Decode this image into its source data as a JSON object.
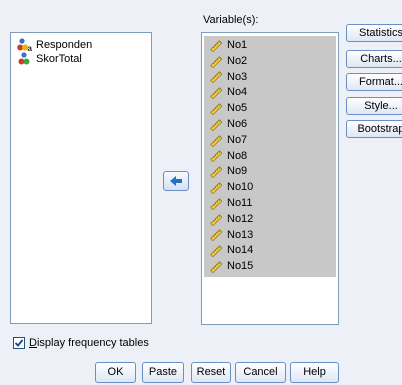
{
  "source_list": {
    "items": [
      {
        "label": "Responden",
        "icon": "nominal-string-variable-icon"
      },
      {
        "label": "SkorTotal",
        "icon": "nominal-variable-icon"
      }
    ]
  },
  "target_list": {
    "label": "Variable(s):",
    "items": [
      {
        "label": "No1",
        "icon": "scale-ruler-icon"
      },
      {
        "label": "No2",
        "icon": "scale-ruler-icon"
      },
      {
        "label": "No3",
        "icon": "scale-ruler-icon"
      },
      {
        "label": "No4",
        "icon": "scale-ruler-icon"
      },
      {
        "label": "No5",
        "icon": "scale-ruler-icon"
      },
      {
        "label": "No6",
        "icon": "scale-ruler-icon"
      },
      {
        "label": "No7",
        "icon": "scale-ruler-icon"
      },
      {
        "label": "No8",
        "icon": "scale-ruler-icon"
      },
      {
        "label": "No9",
        "icon": "scale-ruler-icon"
      },
      {
        "label": "No10",
        "icon": "scale-ruler-icon"
      },
      {
        "label": "No11",
        "icon": "scale-ruler-icon"
      },
      {
        "label": "No12",
        "icon": "scale-ruler-icon"
      },
      {
        "label": "No13",
        "icon": "scale-ruler-icon"
      },
      {
        "label": "No14",
        "icon": "scale-ruler-icon"
      },
      {
        "label": "No15",
        "icon": "scale-ruler-icon"
      }
    ]
  },
  "side_buttons": {
    "statistics": "Statistics",
    "charts": "Charts...",
    "format": "Format...",
    "style": "Style...",
    "bootstrap": "Bootstrap"
  },
  "move_button": {
    "icon": "arrow-left-icon"
  },
  "display_frequency": {
    "label": "Display frequency tables",
    "checked": true
  },
  "bottom_buttons": {
    "ok": "OK",
    "paste": "Paste",
    "reset": "Reset",
    "cancel": "Cancel",
    "help": "Help"
  },
  "colors": {
    "background": "#edf1f7",
    "selection": "#c8c8c8",
    "button_border": "#6b8fc3",
    "arrow_blue": "#2b6fc0"
  }
}
